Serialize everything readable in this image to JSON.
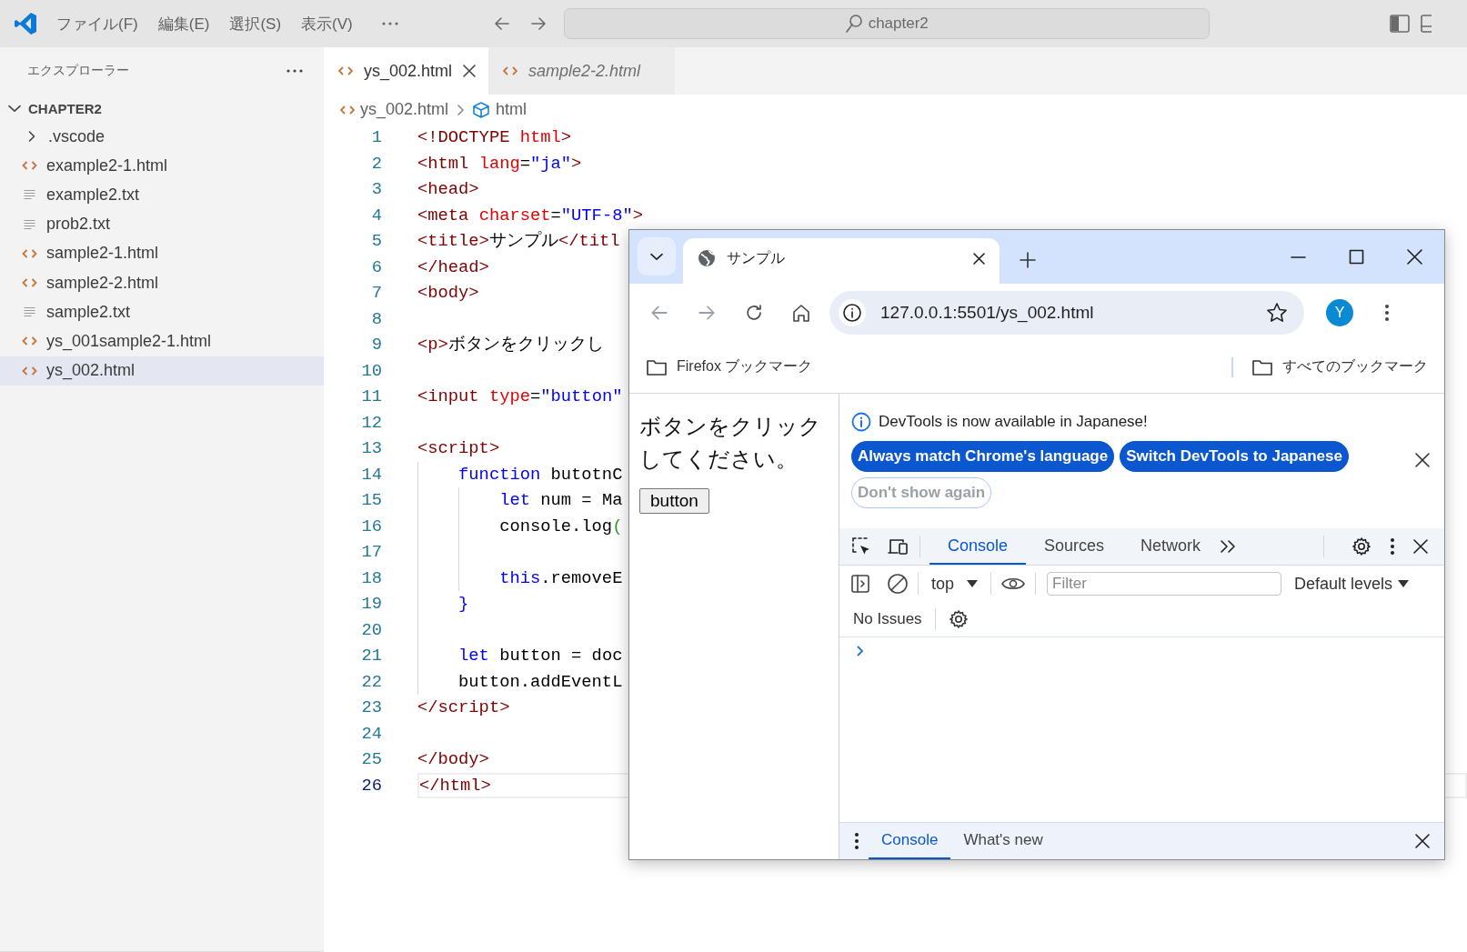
{
  "titlebar": {
    "menus": [
      "ファイル(F)",
      "編集(E)",
      "選択(S)",
      "表示(V)"
    ],
    "search": "chapter2"
  },
  "sidebar": {
    "title": "エクスプローラー",
    "folder": {
      "name": "CHAPTER2",
      "expanded": true,
      "children": [
        {
          "name": ".vscode",
          "kind": "folder",
          "expanded": false,
          "selected": false
        },
        {
          "name": "example2-1.html",
          "kind": "html",
          "selected": false
        },
        {
          "name": "example2.txt",
          "kind": "text",
          "selected": false
        },
        {
          "name": "prob2.txt",
          "kind": "text",
          "selected": false
        },
        {
          "name": "sample2-1.html",
          "kind": "html",
          "selected": false
        },
        {
          "name": "sample2-2.html",
          "kind": "html",
          "selected": false
        },
        {
          "name": "sample2.txt",
          "kind": "text",
          "selected": false
        },
        {
          "name": "ys_001sample2-1.html",
          "kind": "html",
          "selected": false
        },
        {
          "name": "ys_002.html",
          "kind": "html",
          "selected": true
        }
      ]
    }
  },
  "editor": {
    "tabs": [
      {
        "label": "ys_002.html",
        "selected": true,
        "preview": false
      },
      {
        "label": "sample2-2.html",
        "selected": false,
        "preview": true
      }
    ],
    "breadcrumb": [
      {
        "label": "ys_002.html",
        "kind": "file"
      },
      {
        "label": "html",
        "kind": "element"
      }
    ],
    "lines": [
      {
        "number": "1",
        "current": false,
        "tokens": [
          {
            "kind": "tag",
            "text": "<!DOCTYPE "
          },
          {
            "kind": "attr",
            "text": "html"
          },
          {
            "kind": "tag",
            "text": ">"
          }
        ]
      },
      {
        "number": "2",
        "current": false,
        "tokens": [
          {
            "kind": "tag",
            "text": "<html "
          },
          {
            "kind": "attr",
            "text": "lang"
          },
          {
            "kind": "plain",
            "text": "="
          },
          {
            "kind": "value",
            "text": "\"ja\""
          },
          {
            "kind": "tag",
            "text": ">"
          }
        ]
      },
      {
        "number": "3",
        "current": false,
        "tokens": [
          {
            "kind": "tag",
            "text": "<head>"
          }
        ]
      },
      {
        "number": "4",
        "current": false,
        "tokens": [
          {
            "kind": "tag",
            "text": "<meta "
          },
          {
            "kind": "attr",
            "text": "charset"
          },
          {
            "kind": "plain",
            "text": "="
          },
          {
            "kind": "value",
            "text": "\"UTF-8\""
          },
          {
            "kind": "tag",
            "text": ">"
          }
        ]
      },
      {
        "number": "5",
        "current": false,
        "tokens": [
          {
            "kind": "tag",
            "text": "<title>"
          },
          {
            "kind": "plain",
            "text": "サンプル"
          },
          {
            "kind": "tag",
            "text": "</titl"
          }
        ]
      },
      {
        "number": "6",
        "current": false,
        "tokens": [
          {
            "kind": "tag",
            "text": "</head>"
          }
        ]
      },
      {
        "number": "7",
        "current": false,
        "tokens": [
          {
            "kind": "tag",
            "text": "<body>"
          }
        ]
      },
      {
        "number": "8",
        "current": false
      },
      {
        "number": "9",
        "current": false,
        "tokens": [
          {
            "kind": "tag",
            "text": "<p>"
          },
          {
            "kind": "plain",
            "text": "ボタンをクリックし"
          }
        ]
      },
      {
        "number": "10",
        "current": false
      },
      {
        "number": "11",
        "current": false,
        "tokens": [
          {
            "kind": "tag",
            "text": "<input "
          },
          {
            "kind": "attr",
            "text": "type"
          },
          {
            "kind": "plain",
            "text": "="
          },
          {
            "kind": "value",
            "text": "\"button\""
          }
        ]
      },
      {
        "number": "12",
        "current": false
      },
      {
        "number": "13",
        "current": false,
        "tokens": [
          {
            "kind": "tag",
            "text": "<script>"
          }
        ]
      },
      {
        "number": "14",
        "current": false,
        "tokens": [
          {
            "kind": "keyword",
            "text": "    function"
          },
          {
            "kind": "plain",
            "text": " butotnC"
          }
        ]
      },
      {
        "number": "15",
        "current": false,
        "tokens": [
          {
            "kind": "keyword",
            "text": "        let"
          },
          {
            "kind": "plain",
            "text": " num = Ma"
          }
        ]
      },
      {
        "number": "16",
        "current": false,
        "tokens": [
          {
            "kind": "plain",
            "text": "        console.log"
          },
          {
            "kind": "bracket",
            "text": "("
          }
        ]
      },
      {
        "number": "17",
        "current": false
      },
      {
        "number": "18",
        "current": false,
        "tokens": [
          {
            "kind": "keyword",
            "text": "        this"
          },
          {
            "kind": "plain",
            "text": ".removeE"
          }
        ]
      },
      {
        "number": "19",
        "current": false,
        "tokens": [
          {
            "kind": "keyword",
            "text": "    }"
          }
        ]
      },
      {
        "number": "20",
        "current": false
      },
      {
        "number": "21",
        "current": false,
        "tokens": [
          {
            "kind": "keyword",
            "text": "    let"
          },
          {
            "kind": "plain",
            "text": " button = doc"
          }
        ]
      },
      {
        "number": "22",
        "current": false,
        "tokens": [
          {
            "kind": "plain",
            "text": "    button.addEventL"
          }
        ]
      },
      {
        "number": "23",
        "current": false,
        "tokens": [
          {
            "kind": "tag",
            "text": "</script>"
          }
        ]
      },
      {
        "number": "24",
        "current": false
      },
      {
        "number": "25",
        "current": false,
        "tokens": [
          {
            "kind": "tag",
            "text": "</body>"
          }
        ]
      },
      {
        "number": "26",
        "current": true,
        "tokens": [
          {
            "kind": "tag",
            "text": "</html>"
          }
        ]
      }
    ]
  },
  "browser": {
    "tab": {
      "title": "サンプル"
    },
    "url": "127.0.0.1:5501/ys_002.html",
    "profile": "Y",
    "bookmarks": [
      "Firefox ブックマーク"
    ],
    "all_bookmarks": "すべてのブックマーク",
    "page": {
      "text": "ボタンをクリックしてください。",
      "button": "button"
    },
    "devtools": {
      "infobar": {
        "message": "DevTools is now available in Japanese!",
        "actions": [
          {
            "label": "Always match Chrome's language",
            "kind": "primary"
          },
          {
            "label": "Switch DevTools to Japanese",
            "kind": "primary"
          },
          {
            "label": "Don't show again",
            "kind": "secondary"
          }
        ]
      },
      "tabs": [
        {
          "label": "Console",
          "selected": true
        },
        {
          "label": "Sources",
          "selected": false
        },
        {
          "label": "Network",
          "selected": false
        }
      ],
      "context": "top",
      "filter_placeholder": "Filter",
      "levels": "Default levels",
      "issues": "No Issues",
      "drawer_tabs": [
        {
          "label": "Console",
          "selected": true
        },
        {
          "label": "What's new",
          "selected": false
        }
      ]
    }
  }
}
